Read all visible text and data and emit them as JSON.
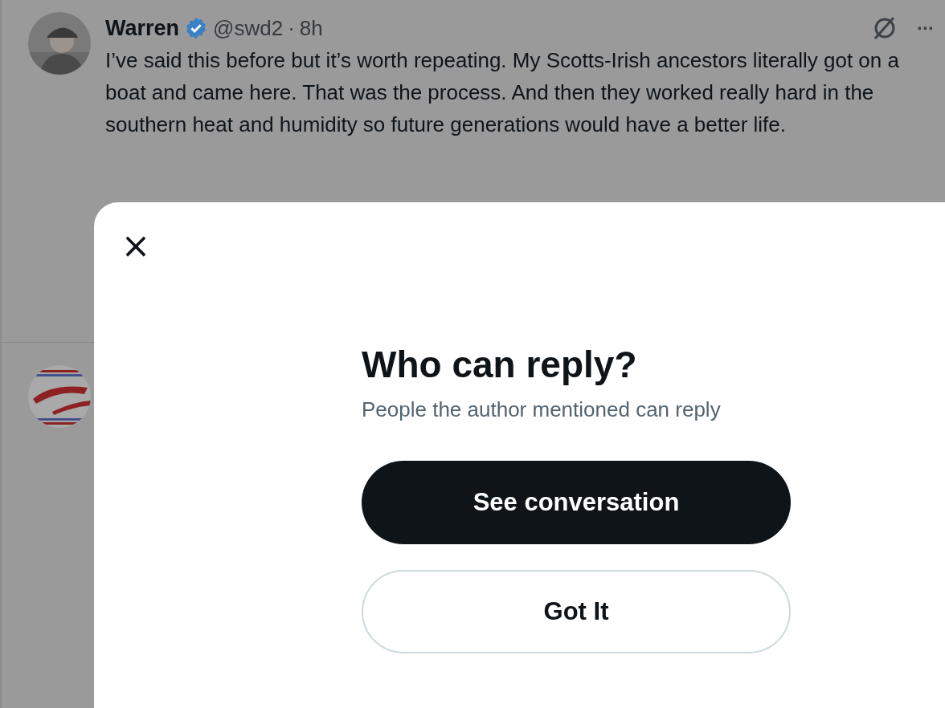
{
  "tweet": {
    "author": "Warren",
    "verified": true,
    "handle": "@swd2",
    "separator": "·",
    "time": "8h",
    "more": "···",
    "text": "I’ve said this before but it’s worth repeating. My Scotts-Irish ancestors literally got on a boat and came here. That was the process. And then they worked really hard in the southern heat and humidity so future generations would have a better life."
  },
  "modal": {
    "close": "×",
    "title": "Who can reply?",
    "subtitle": "People the author mentioned can reply",
    "buttons": [
      {
        "label": "See conversation",
        "kind": "primary"
      },
      {
        "label": "Got It",
        "kind": "secondary"
      }
    ]
  }
}
